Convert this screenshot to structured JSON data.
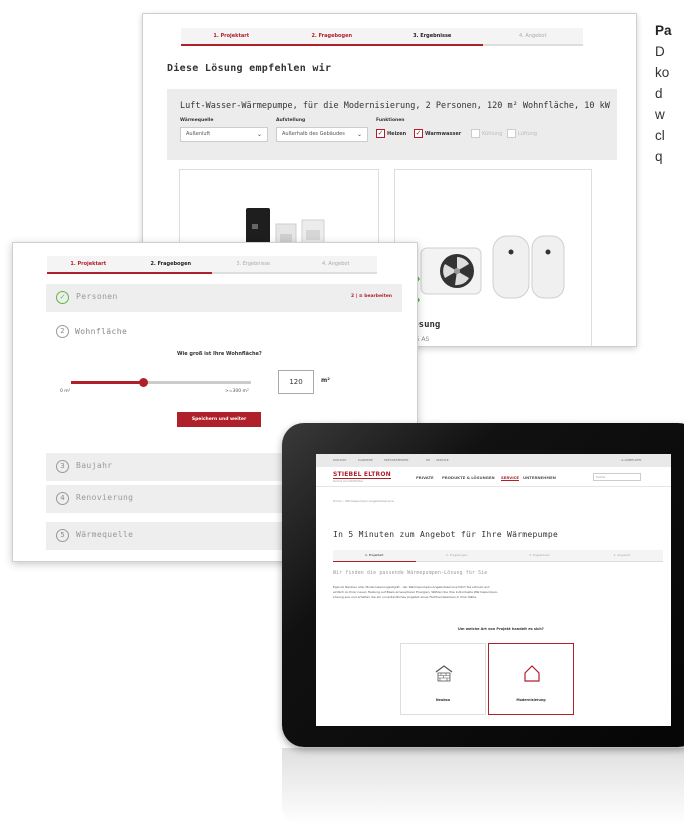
{
  "side_text": [
    "Pa",
    "D",
    "ko",
    "d",
    "w",
    "cl",
    "q"
  ],
  "results": {
    "steps": [
      "1. Projektart",
      "2. Fragebogen",
      "3. Ergebnisse",
      "4. Angebot"
    ],
    "title": "Diese Lösung empfehlen wir",
    "config_title": "Luft-Wasser-Wärmepumpe, für die Modernisierung, 2 Personen, 120 m² Wohnfläche, 10 kW",
    "waermequelle_label": "Wärmequelle",
    "waermequelle_value": "Außenluft",
    "aufstellung_label": "Aufstellung",
    "aufstellung_value": "Außerhalb des Gebäudes",
    "funktionen_label": "Funktionen",
    "funktionen": [
      {
        "label": "Heizen",
        "checked": true
      },
      {
        "label": "Warmwasser",
        "checked": true
      },
      {
        "label": "Kühlung",
        "checked": false
      },
      {
        "label": "Lüftung",
        "checked": false
      }
    ],
    "product_name": "s-Lösung",
    "product_sub": "WPL 15 AS"
  },
  "questionnaire": {
    "steps": [
      "1. Projektart",
      "2. Fragebogen",
      "3. Ergebnisse",
      "4. Angebot"
    ],
    "sections": [
      {
        "num": "✓",
        "label": "Personen",
        "status": "done",
        "edit": "2 | ≡ bearbeiten"
      },
      {
        "num": "2",
        "label": "Wohnfläche",
        "status": "active"
      },
      {
        "num": "3",
        "label": "Baujahr",
        "status": "todo"
      },
      {
        "num": "4",
        "label": "Renovierung",
        "status": "todo"
      },
      {
        "num": "5",
        "label": "Wärmequelle",
        "status": "todo"
      }
    ],
    "question": "Wie groß ist Ihre Wohnfläche?",
    "slider_min": "0 m²",
    "slider_max": ">=300 m²",
    "value_fraction": 0.4,
    "value": "120",
    "unit": "m²",
    "save_button": "Speichern und weiter"
  },
  "tablet": {
    "topbar": [
      "KONTAKT",
      "KARRIERE",
      "PRESSE/MEDIEN",
      "DE",
      "SERVICE",
      "≡ ANMELDEN"
    ],
    "logo": "STIEBEL ELTRON",
    "logo_sub": "Technik zum Wohlfühlen",
    "nav": [
      "PRIVATE",
      "PRODUKTE & LÖSUNGEN",
      "SERVICE",
      "UNTERNEHMEN"
    ],
    "nav_active": 2,
    "search_placeholder": "Suche",
    "breadcrumb": "Home › Wärmepumpen-Angebotsservice",
    "title": "In 5 Minuten zum Angebot für Ihre Wärmepumpe",
    "steps": [
      "1. Projektart",
      "2. Fragebogen",
      "3. Ergebnisse",
      "4. Angebot"
    ],
    "subtitle": "Wir finden die passende Wärmepumpen-Lösung für Sie",
    "body": "Egal ob Neubau oder Modernisierungsobjekt - der Wärmepumpen-Angebotsservice führt Sie schnell und einfach zu Ihrer neuen Heizung auf Basis erneuerbarer Energien. Wählen Sie Ihre individuelle Wärmepumpen-Lösung aus und erhalten Sie ein unverbindliches Angebot eines Fachhandwerkers in Ihrer Nähe.",
    "question": "Um welche Art von Projekt handelt es sich?",
    "options": [
      "Neubau",
      "Modernisierung"
    ],
    "selected_option": 1
  },
  "colors": {
    "accent": "#b0202a",
    "success": "#5db93c"
  }
}
